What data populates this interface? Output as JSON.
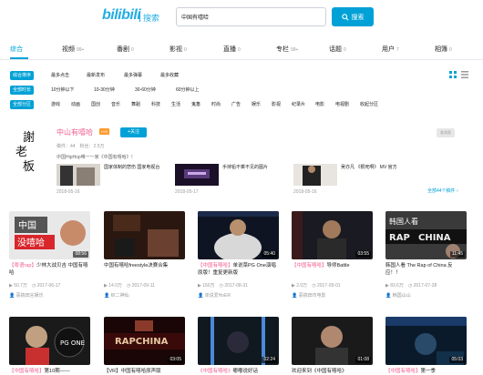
{
  "header": {
    "logo": "bilibili",
    "logo_sub": "搜索",
    "search_value": "中国有嘻哈",
    "search_button": "搜索"
  },
  "tabs": [
    {
      "label": "综合",
      "count": ""
    },
    {
      "label": "视频",
      "count": "99+"
    },
    {
      "label": "番剧",
      "count": "0"
    },
    {
      "label": "影视",
      "count": "0"
    },
    {
      "label": "直播",
      "count": "0"
    },
    {
      "label": "专栏",
      "count": "99+"
    },
    {
      "label": "话题",
      "count": "0"
    },
    {
      "label": "用户",
      "count": "7"
    },
    {
      "label": "相簿",
      "count": "0"
    }
  ],
  "filters": {
    "sort": [
      "综合排序",
      "最多点击",
      "最新发布",
      "最多弹幕",
      "最多收藏"
    ],
    "duration": [
      "全部时长",
      "10分钟以下",
      "10-30分钟",
      "30-60分钟",
      "60分钟以上"
    ],
    "zone": [
      "全部分区",
      "游戏",
      "动画",
      "国创",
      "音乐",
      "舞蹈",
      "科技",
      "生活",
      "鬼畜",
      "时尚",
      "广告",
      "娱乐",
      "影视",
      "纪录片",
      "电影",
      "电视剧",
      "收起分区"
    ]
  },
  "up_user": {
    "avatar_text": "謝老板",
    "name": "中山有嘻哈",
    "level": "LV5",
    "follow": "+关注",
    "msg": "发消息",
    "stats": "稿件：44　粉丝：2.5万",
    "desc": "中国HipHop唯一一家《中国有嘻哈》！",
    "videos": [
      {
        "title": "国家体制的悲伤 国家电视台",
        "date": "2018-05-16"
      },
      {
        "title": "手持铅不乘不见的图片",
        "date": "2018-05-17"
      },
      {
        "title": "吴亦凡 《狠死啊》 MV 官方",
        "date": "2018-05-16"
      }
    ],
    "more": "全部44个稿件 ›"
  },
  "videos": [
    {
      "thumb_text": "中国 没嘻哈",
      "duration": "08:56",
      "title_hl": "【粤语rap】",
      "title": "少林大战贝吉 中国有嘻哈",
      "views": "50.7万",
      "date": "2017-06-17",
      "up": "恶搞田言娱乐"
    },
    {
      "thumb_text": "",
      "duration": "",
      "title_hl": "",
      "title": "中国有嘻哈freestyle决赛合集",
      "views": "14.0万",
      "date": "2017-09-11",
      "up": "织二神仙"
    },
    {
      "thumb_text": "",
      "duration": "05:40",
      "title_hl": "【中国有嘻哈】",
      "title": "单说菜PG One演唱原版！重复更新版",
      "views": "160万",
      "date": "2017-08-31",
      "up": "单说爱HoER"
    },
    {
      "thumb_text": "",
      "duration": "03:55",
      "title_hl": "【中国有嘻哈】",
      "title": "导师Battle",
      "views": "2.0万",
      "date": "2017-09-01",
      "up": "恶搞田市电影"
    },
    {
      "thumb_text": "韩国人看 RAP OF CHINA",
      "duration": "11:45",
      "title_hl": "",
      "title": "韩国人看 The Rap of China 反应！！",
      "views": "83.6万",
      "date": "2017-07-28",
      "up": "韩国山山"
    },
    {
      "thumb_text": "PG ONE",
      "duration": "",
      "title_hl": "【中国有嘻哈】",
      "title": "第10期——",
      "views": "",
      "date": "",
      "up": ""
    },
    {
      "thumb_text": "RAP CHINA",
      "duration": "03:05",
      "title_hl": "",
      "title": "【VR】中国有嘻哈原声版",
      "views": "",
      "date": "",
      "up": ""
    },
    {
      "thumb_text": "",
      "duration": "02:24",
      "title_hl": "《中国有嘻哈》",
      "title": "嘟嘟说好话",
      "views": "",
      "date": "",
      "up": ""
    },
    {
      "thumb_text": "",
      "duration": "01:08",
      "title_hl": "",
      "title": "欢迎来到《中国有嘻哈》",
      "views": "",
      "date": "",
      "up": ""
    },
    {
      "thumb_text": "",
      "duration": "05:03",
      "title_hl": "【中国有嘻哈】",
      "title": "第一季",
      "views": "",
      "date": "",
      "up": ""
    }
  ]
}
